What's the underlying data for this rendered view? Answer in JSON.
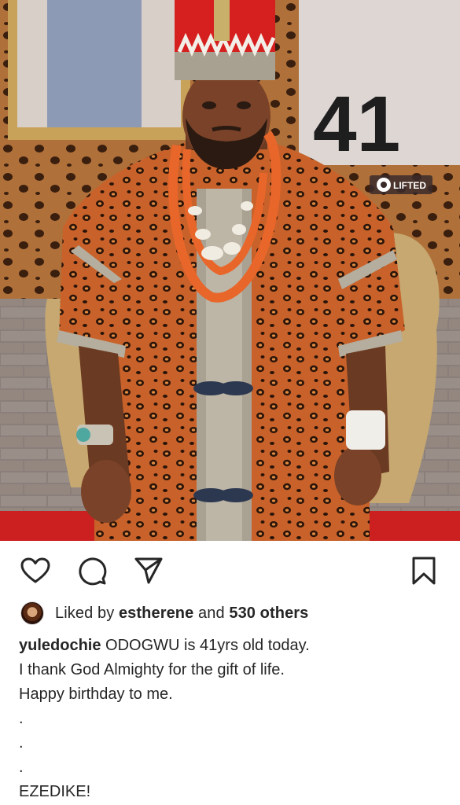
{
  "post": {
    "overlay_number": "41",
    "watermark": "LIFTED"
  },
  "actions": {
    "like_icon": "heart-icon",
    "comment_icon": "comment-icon",
    "share_icon": "send-icon",
    "save_icon": "bookmark-icon"
  },
  "likes": {
    "prefix": "Liked by ",
    "user": "estherene",
    "middle": " and ",
    "others": "530 others"
  },
  "caption": {
    "username": "yuledochie",
    "line1": " ODOGWU is 41yrs old today.",
    "line2": "I thank God Almighty for the gift of life.",
    "line3": "Happy birthday to me.",
    "dot1": ".",
    "dot2": ".",
    "dot3": ".",
    "line4": "EZEDIKE!"
  }
}
